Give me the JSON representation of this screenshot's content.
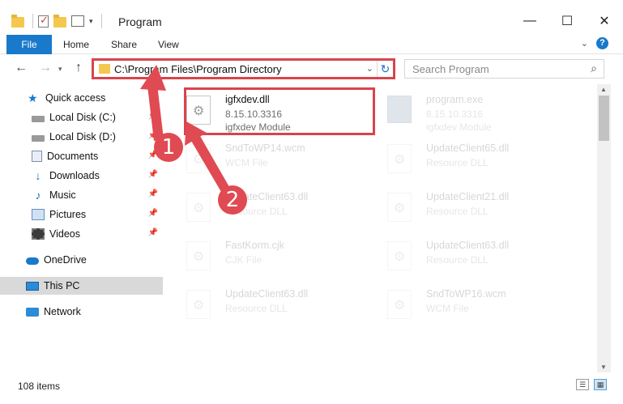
{
  "window": {
    "title": "Program",
    "minimize": "—",
    "maximize": "☐",
    "close": "✕"
  },
  "ribbon": {
    "tabs": [
      "File",
      "Home",
      "Share",
      "View"
    ]
  },
  "address": {
    "path": "C:\\Program Files\\Program Directory",
    "search_placeholder": "Search Program"
  },
  "sidebar": {
    "items": [
      {
        "label": "Quick access",
        "icon": "star-icon",
        "pinned": false
      },
      {
        "label": "Local Disk (C:)",
        "icon": "drive-icon",
        "pinned": true
      },
      {
        "label": "Local Disk (D:)",
        "icon": "drive-icon",
        "pinned": true
      },
      {
        "label": "Documents",
        "icon": "documents-icon",
        "pinned": true
      },
      {
        "label": "Downloads",
        "icon": "download-icon",
        "pinned": true
      },
      {
        "label": "Music",
        "icon": "music-icon",
        "pinned": true
      },
      {
        "label": "Pictures",
        "icon": "pictures-icon",
        "pinned": true
      },
      {
        "label": "Videos",
        "icon": "videos-icon",
        "pinned": true
      },
      {
        "label": "OneDrive",
        "icon": "onedrive-icon",
        "pinned": false
      },
      {
        "label": "This PC",
        "icon": "this-pc-icon",
        "pinned": false,
        "selected": true
      },
      {
        "label": "Network",
        "icon": "network-icon",
        "pinned": false
      }
    ]
  },
  "files": [
    {
      "name": "igfxdev.dll",
      "meta1": "8.15.10.3316",
      "meta2": "igfxdev Module",
      "highlighted": true
    },
    {
      "name": "program.exe",
      "meta1": "8.15.10.3316",
      "meta2": "igfxdev Module"
    },
    {
      "name": "SndToWP14.wcm",
      "meta1": "WCM File",
      "meta2": ""
    },
    {
      "name": "UpdateClient65.dll",
      "meta1": "Resource DLL",
      "meta2": ""
    },
    {
      "name": "UpdateClient63.dll",
      "meta1": "Resource DLL",
      "meta2": ""
    },
    {
      "name": "UpdateClient21.dll",
      "meta1": "Resource DLL",
      "meta2": ""
    },
    {
      "name": "FastKorm.cjk",
      "meta1": "CJK File",
      "meta2": ""
    },
    {
      "name": "UpdateClient63.dll",
      "meta1": "Resource DLL",
      "meta2": ""
    },
    {
      "name": "UpdateClient63.dll",
      "meta1": "Resource DLL",
      "meta2": ""
    },
    {
      "name": "SndToWP16.wcm",
      "meta1": "WCM File",
      "meta2": ""
    }
  ],
  "status": {
    "item_count": "108 items"
  },
  "callouts": [
    "1",
    "2"
  ],
  "colors": {
    "accent": "#1979ca",
    "highlight_red": "#d9444d",
    "callout_red": "#e04a52"
  }
}
